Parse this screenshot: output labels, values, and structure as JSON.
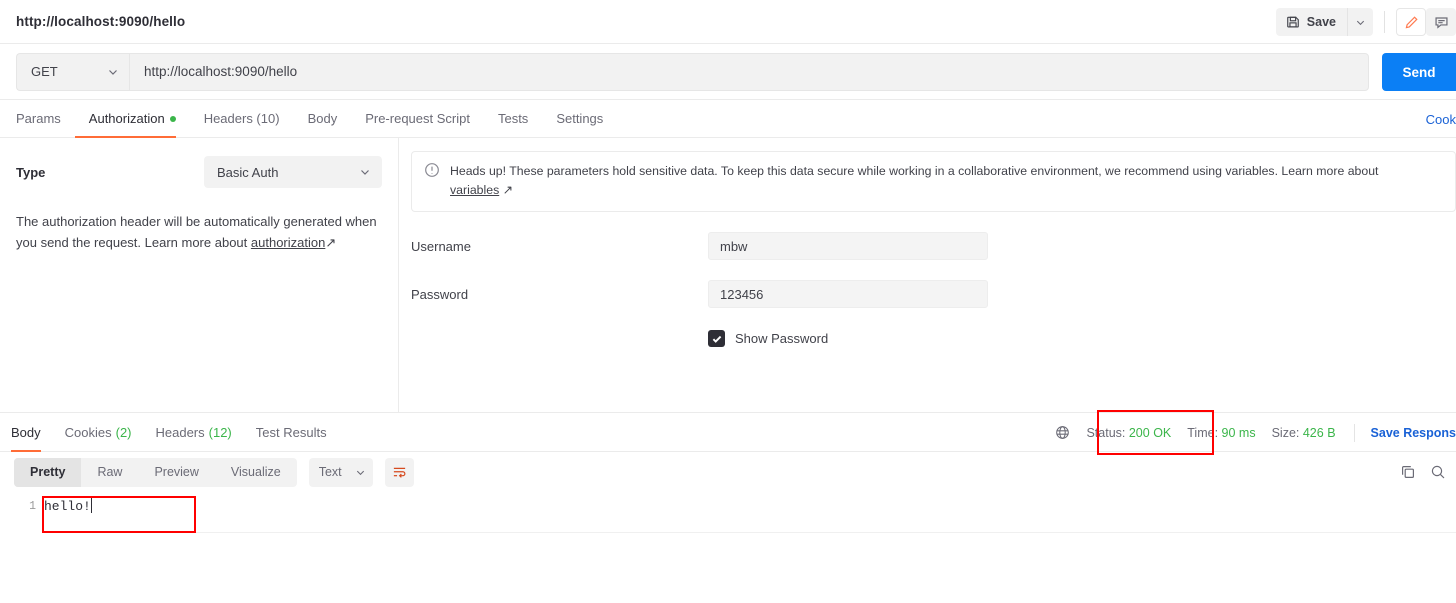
{
  "topbar": {
    "request_title": "http://localhost:9090/hello",
    "save_label": "Save",
    "save_icon": "floppy-disk-icon",
    "caret_icon": "chevron-down-icon",
    "edit_icon": "pencil-icon",
    "comment_icon": "comment-icon"
  },
  "url_row": {
    "method": "GET",
    "url": "http://localhost:9090/hello",
    "send_label": "Send"
  },
  "request_tabs": {
    "items": [
      {
        "label": "Params",
        "active": false,
        "dot": false
      },
      {
        "label": "Authorization",
        "active": true,
        "dot": true
      },
      {
        "label": "Headers (10)",
        "active": false,
        "dot": false
      },
      {
        "label": "Body",
        "active": false,
        "dot": false
      },
      {
        "label": "Pre-request Script",
        "active": false,
        "dot": false
      },
      {
        "label": "Tests",
        "active": false,
        "dot": false
      },
      {
        "label": "Settings",
        "active": false,
        "dot": false
      }
    ],
    "cookies_link": "Cook"
  },
  "auth": {
    "type_label": "Type",
    "type_value": "Basic Auth",
    "description_1": "The authorization header will be automatically generated when you send the request. Learn more about ",
    "description_link": "authorization",
    "description_arrow": "↗",
    "notice_icon": "alert-circle-icon",
    "notice_text": "Heads up! These parameters hold sensitive data. To keep this data secure while working in a collaborative environment, we recommend using variables. Learn more about ",
    "notice_link": "variables",
    "notice_arrow": "↗",
    "username_label": "Username",
    "username_value": "mbw",
    "password_label": "Password",
    "password_value": "123456",
    "show_password_label": "Show Password",
    "show_password_checked": true
  },
  "response": {
    "tabs": [
      {
        "label": "Body",
        "count": "",
        "active": true
      },
      {
        "label": "Cookies",
        "count": "(2)",
        "active": false
      },
      {
        "label": "Headers",
        "count": "(12)",
        "active": false
      },
      {
        "label": "Test Results",
        "count": "",
        "active": false
      }
    ],
    "globe_icon": "globe-icon",
    "status_label": "Status:",
    "status_value": "200 OK",
    "time_label": "Time:",
    "time_value": "90 ms",
    "size_label": "Size:",
    "size_value": "426 B",
    "save_response_label": "Save Respons",
    "toolbar": {
      "segments": [
        {
          "label": "Pretty",
          "active": true
        },
        {
          "label": "Raw",
          "active": false
        },
        {
          "label": "Preview",
          "active": false
        },
        {
          "label": "Visualize",
          "active": false
        }
      ],
      "format": "Text",
      "format_caret_icon": "chevron-down-icon",
      "wrap_icon": "wrap-lines-icon",
      "copy_icon": "copy-icon",
      "search_icon": "search-icon"
    },
    "body": {
      "line_number": "1",
      "content": "hello!"
    }
  },
  "colors": {
    "accent_orange": "#ff6c37",
    "send_blue": "#0b7ff5",
    "link_blue": "#1a62d6",
    "status_green": "#3bb54a",
    "annotation_red": "#ff0000"
  }
}
